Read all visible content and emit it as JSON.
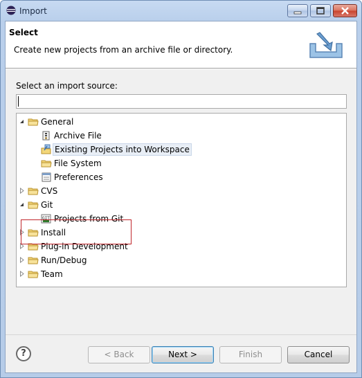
{
  "window": {
    "title": "Import",
    "controls": [
      "minimize",
      "maximize",
      "close"
    ]
  },
  "banner": {
    "title": "Select",
    "description": "Create new projects from an archive file or directory.",
    "icon": "import-wizard-icon"
  },
  "source": {
    "label": "Select an import source:",
    "filter_value": "",
    "filter_placeholder": ""
  },
  "tree": {
    "items": [
      {
        "label": "General",
        "level": 0,
        "expanded": true,
        "icon": "folder-icon"
      },
      {
        "label": "Archive File",
        "level": 1,
        "icon": "archive-icon"
      },
      {
        "label": "Existing Projects into Workspace",
        "level": 1,
        "icon": "project-import-icon",
        "selected": true
      },
      {
        "label": "File System",
        "level": 1,
        "icon": "folder-icon"
      },
      {
        "label": "Preferences",
        "level": 1,
        "icon": "preferences-icon"
      },
      {
        "label": "CVS",
        "level": 0,
        "expanded": false,
        "icon": "folder-icon"
      },
      {
        "label": "Git",
        "level": 0,
        "expanded": true,
        "icon": "folder-icon",
        "highlighted": true
      },
      {
        "label": "Projects from Git",
        "level": 1,
        "icon": "git-icon",
        "highlighted": true
      },
      {
        "label": "Install",
        "level": 0,
        "expanded": false,
        "icon": "folder-icon"
      },
      {
        "label": "Plug-in Development",
        "level": 0,
        "expanded": false,
        "icon": "folder-icon"
      },
      {
        "label": "Run/Debug",
        "level": 0,
        "expanded": false,
        "icon": "folder-icon"
      },
      {
        "label": "Team",
        "level": 0,
        "expanded": false,
        "icon": "folder-icon"
      }
    ]
  },
  "buttons": {
    "help": "?",
    "back": "< Back",
    "next": "Next >",
    "finish": "Finish",
    "cancel": "Cancel"
  },
  "colors": {
    "highlight_box": "#c0262b",
    "selection": "#e8eef6",
    "folder": "#e8c65a"
  }
}
